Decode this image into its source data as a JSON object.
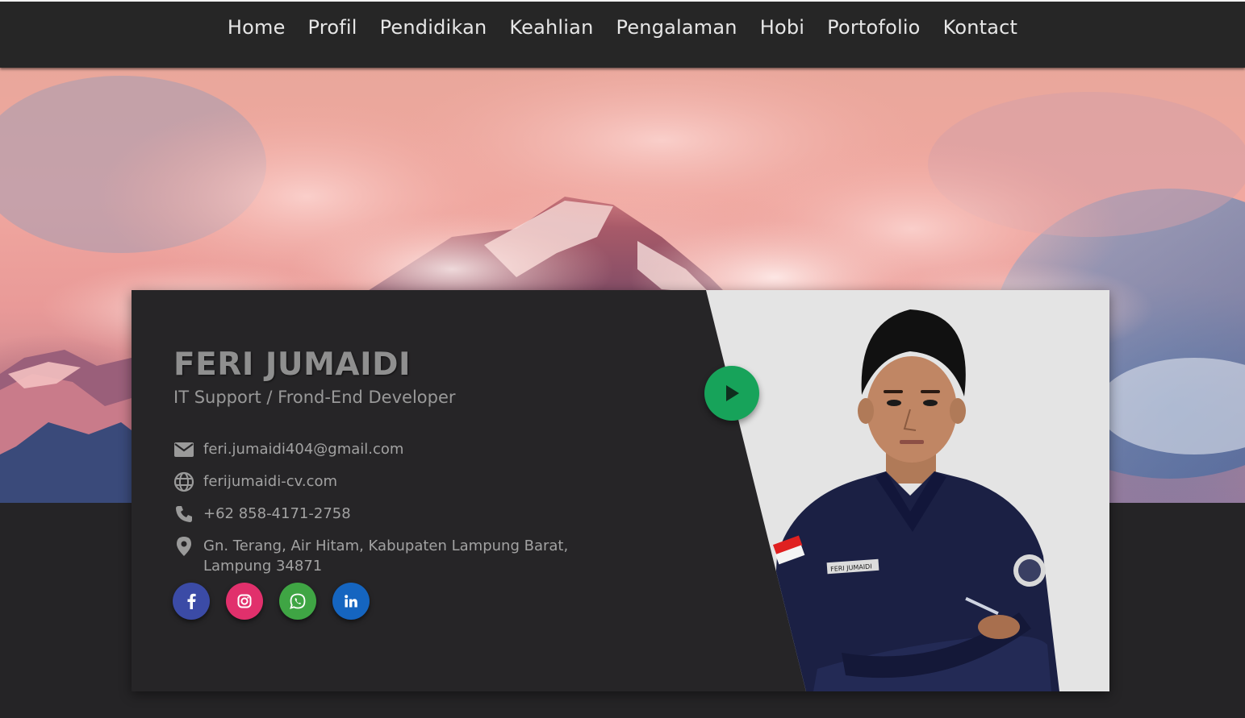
{
  "nav": {
    "items": [
      "Home",
      "Profil",
      "Pendidikan",
      "Keahlian",
      "Pengalaman",
      "Hobi",
      "Portofolio",
      "Kontact"
    ]
  },
  "profile": {
    "name": "FERI JUMAIDI",
    "role": "IT Support / Frond-End Developer",
    "email": "feri.jumaidi404@gmail.com",
    "website": "ferijumaidi-cv.com",
    "phone": "+62 858-4171-2758",
    "address_line1": "Gn. Terang, Air Hitam, Kabupaten Lampung Barat,",
    "address_line2": "Lampung 34871",
    "photo_badge": "FERI JUMAIDI"
  },
  "icons": {
    "email": "email-icon",
    "website": "globe-icon",
    "phone": "phone-icon",
    "address": "location-pin-icon",
    "play": "play-icon"
  },
  "socials": [
    {
      "name": "facebook",
      "icon": "facebook-icon",
      "color": "#3b4ba6"
    },
    {
      "name": "instagram",
      "icon": "instagram-icon",
      "color": "#e1306c"
    },
    {
      "name": "whatsapp",
      "icon": "whatsapp-icon",
      "color": "#3fa544"
    },
    {
      "name": "linkedin",
      "icon": "linkedin-icon",
      "color": "#1565c0"
    }
  ],
  "colors": {
    "background": "#252426",
    "card": "#262527",
    "play_button": "#17a35a",
    "nav_text": "#e6e6e6"
  }
}
